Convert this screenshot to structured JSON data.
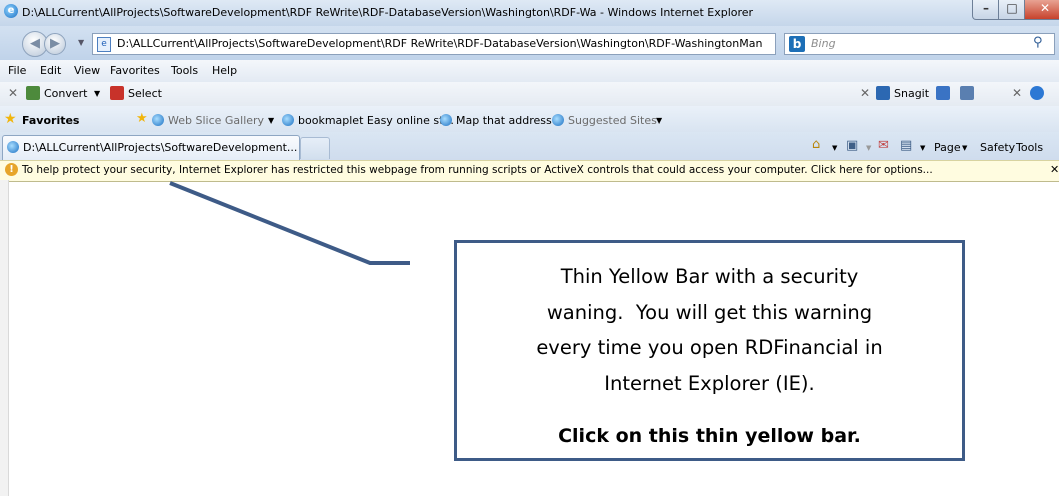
{
  "window": {
    "title": "D:\\ALLCurrent\\AllProjects\\SoftwareDevelopment\\RDF ReWrite\\RDF-DatabaseVersion\\Washington\\RDF-Wa - Windows Internet Explorer",
    "minimize": "–",
    "maximize": "□",
    "close": "✕"
  },
  "address_bar": {
    "url": "D:\\ALLCurrent\\AllProjects\\SoftwareDevelopment\\RDF ReWrite\\RDF-DatabaseVersion\\Washington\\RDF-WashingtonMan"
  },
  "search": {
    "placeholder": "Bing"
  },
  "menu": [
    "File",
    "Edit",
    "View",
    "Favorites",
    "Tools",
    "Help"
  ],
  "convert_toolbar": {
    "convert": "Convert",
    "select": "Select",
    "snagit": "Snagit"
  },
  "favorites_bar": {
    "favorites": "Favorites",
    "items": [
      "Web Slice Gallery",
      "bookmaplet Easy online st...",
      "Map that address",
      "Suggested Sites"
    ]
  },
  "tab": {
    "label": "D:\\ALLCurrent\\AllProjects\\SoftwareDevelopment..."
  },
  "command_bar": {
    "page": "Page",
    "safety": "Safety",
    "tools": "Tools"
  },
  "info_bar": {
    "text": "To help protect your security, Internet Explorer has restricted this webpage from running scripts or ActiveX controls that could access your computer. Click here for options..."
  },
  "callout": {
    "lines": [
      "Thin Yellow Bar with a security",
      "waning.  You will get this warning",
      "every time you open RDFinancial in",
      "Internet Explorer (IE)."
    ],
    "bold": "Click on this thin yellow bar."
  },
  "colors": {
    "info_bar_bg": "#fffce0",
    "callout_border": "#3e5b87"
  }
}
